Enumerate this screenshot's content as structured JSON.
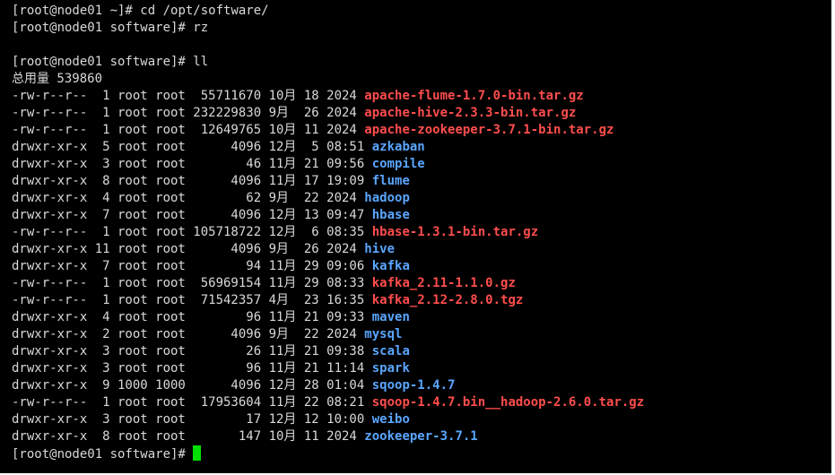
{
  "terminal": {
    "prompt_home": "[root@node01 ~]# ",
    "prompt_sw": "[root@node01 software]# ",
    "cmd1": "cd /opt/software/",
    "cmd2": "rz",
    "cmd3": "ll",
    "total": "总用量 539860",
    "cursor_color": "#00e000",
    "archive_color": "#ff4d4d",
    "dir_color": "#5aa6ff",
    "entries": [
      {
        "meta": "-rw-r--r--  1 root root  55711670 10月 18 2024 ",
        "name": "apache-flume-1.7.0-bin.tar.gz"
      },
      {
        "meta": "-rw-r--r--  1 root root 232229830 9月  26 2024 ",
        "name": "apache-hive-2.3.3-bin.tar.gz"
      },
      {
        "meta": "-rw-r--r--  1 root root  12649765 10月 11 2024 ",
        "name": "apache-zookeeper-3.7.1-bin.tar.gz"
      },
      {
        "meta": "drwxr-xr-x  5 root root      4096 12月  5 08:51 ",
        "name": "azkaban"
      },
      {
        "meta": "drwxr-xr-x  3 root root        46 11月 21 09:56 ",
        "name": "compile"
      },
      {
        "meta": "drwxr-xr-x  8 root root      4096 11月 17 19:09 ",
        "name": "flume"
      },
      {
        "meta": "drwxr-xr-x  4 root root        62 9月  22 2024 ",
        "name": "hadoop"
      },
      {
        "meta": "drwxr-xr-x  7 root root      4096 12月 13 09:47 ",
        "name": "hbase"
      },
      {
        "meta": "-rw-r--r--  1 root root 105718722 12月  6 08:35 ",
        "name": "hbase-1.3.1-bin.tar.gz"
      },
      {
        "meta": "drwxr-xr-x 11 root root      4096 9月  26 2024 ",
        "name": "hive"
      },
      {
        "meta": "drwxr-xr-x  7 root root        94 11月 29 09:06 ",
        "name": "kafka"
      },
      {
        "meta": "-rw-r--r--  1 root root  56969154 11月 29 08:33 ",
        "name": "kafka_2.11-1.1.0.gz"
      },
      {
        "meta": "-rw-r--r--  1 root root  71542357 4月  23 16:35 ",
        "name": "kafka_2.12-2.8.0.tgz"
      },
      {
        "meta": "drwxr-xr-x  4 root root        96 11月 21 09:33 ",
        "name": "maven"
      },
      {
        "meta": "drwxr-xr-x  2 root root      4096 9月  22 2024 ",
        "name": "mysql"
      },
      {
        "meta": "drwxr-xr-x  3 root root        26 11月 21 09:38 ",
        "name": "scala"
      },
      {
        "meta": "drwxr-xr-x  3 root root        96 11月 21 11:14 ",
        "name": "spark"
      },
      {
        "meta": "drwxr-xr-x  9 1000 1000      4096 12月 28 01:04 ",
        "name": "sqoop-1.4.7"
      },
      {
        "meta": "-rw-r--r--  1 root root  17953604 11月 22 08:21 ",
        "name": "sqoop-1.4.7.bin__hadoop-2.6.0.tar.gz"
      },
      {
        "meta": "drwxr-xr-x  3 root root        17 12月 12 10:00 ",
        "name": "weibo"
      },
      {
        "meta": "drwxr-xr-x  8 root root       147 10月 11 2024 ",
        "name": "zookeeper-3.7.1"
      }
    ]
  }
}
